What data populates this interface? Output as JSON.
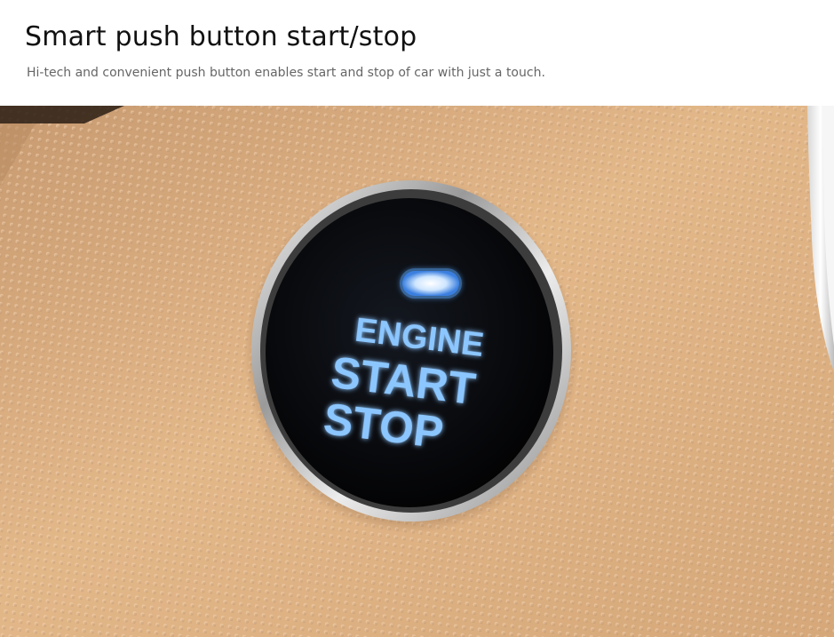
{
  "header": {
    "title": "Smart push button start/stop",
    "subtitle": "Hi-tech and convenient push button enables start and stop of car with just a touch."
  },
  "photo": {
    "button_text": {
      "line1": "ENGINE",
      "line2": "START",
      "line3": "STOP"
    },
    "colors": {
      "panel": "#dcae82",
      "button_face": "#050608",
      "glow": "#5aa8ff",
      "chrome_ring": "#d9d9d9"
    }
  }
}
